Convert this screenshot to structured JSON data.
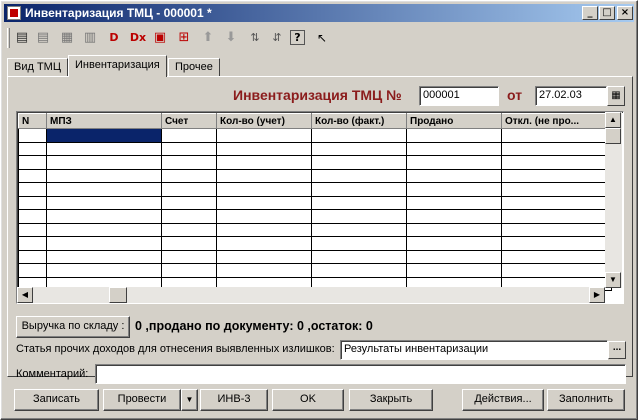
{
  "window": {
    "title": "Инвентаризация ТМЦ - 000001 *",
    "minimize": "_",
    "maximize": "□",
    "close": "×"
  },
  "toolbar": {
    "icons": [
      "new-row-icon",
      "copy-row-icon",
      "edit-row-icon",
      "add-group-icon",
      "mark-delete-icon",
      "delete-icon",
      "end-edit-icon",
      "move-row-icon",
      "move-up-icon",
      "move-down-icon",
      "sort-asc-icon",
      "sort-desc-icon",
      "help-icon",
      "context-help-icon"
    ]
  },
  "tabs": [
    {
      "label": "Вид ТМЦ",
      "active": false
    },
    {
      "label": "Инвентаризация",
      "active": true
    },
    {
      "label": "Прочее",
      "active": false
    }
  ],
  "document": {
    "title_label": "Инвентаризация ТМЦ №",
    "number": "000001",
    "date_label": "от",
    "date": "27.02.03"
  },
  "grid": {
    "columns": [
      "N",
      "МПЗ",
      "Счет",
      "Кол-во (учет)",
      "Кол-во (факт.)",
      "Продано",
      "Откл. (не про..."
    ],
    "row_count": 12
  },
  "sales_button": "Выручка по складу :",
  "summary": "0 ,продано по документу: 0 ,остаток: 0",
  "income": {
    "label": "Статья прочих доходов для отнесения выявленных излишков:",
    "value": "Результаты инвентаризации",
    "select_button": "..."
  },
  "comment": {
    "label": "Комментарий:",
    "value": ""
  },
  "buttons": {
    "write": "Записать",
    "post": "Провести",
    "dropdown": "▼",
    "inv3": "ИНВ-3",
    "ok": "OK",
    "close": "Закрыть",
    "actions": "Действия...",
    "fill": "Заполнить"
  }
}
